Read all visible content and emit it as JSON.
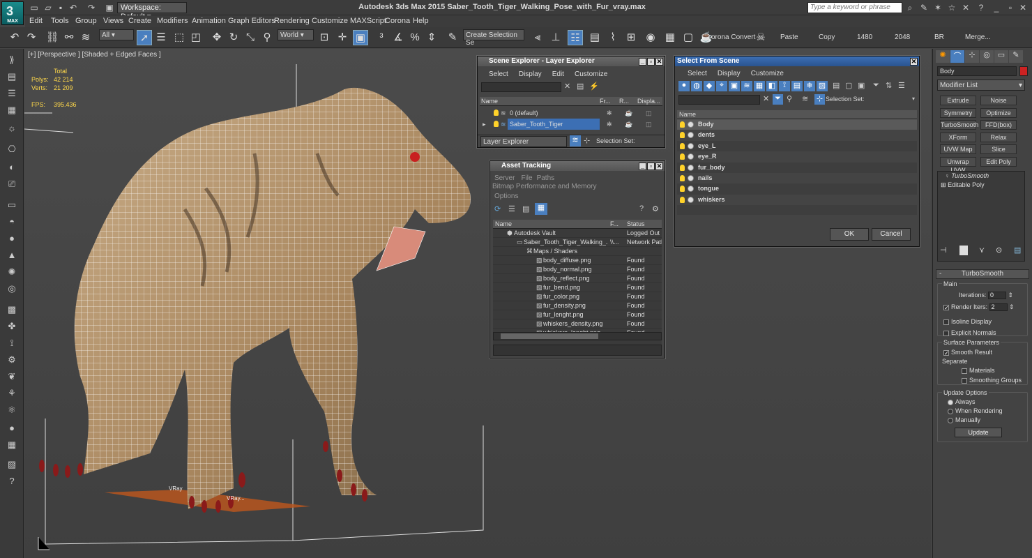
{
  "app": {
    "title": "Autodesk 3ds Max  2015    Saber_Tooth_Tiger_Walking_Pose_with_Fur_vray.max",
    "logo_text": "MAX",
    "workspace": "Workspace: Default",
    "search_placeholder": "Type a keyword or phrase"
  },
  "menu": [
    "Edit",
    "Tools",
    "Group",
    "Views",
    "Create",
    "Modifiers",
    "Animation",
    "Graph Editors",
    "Rendering",
    "Customize",
    "MAXScript",
    "Corona",
    "Help"
  ],
  "toolbar": {
    "selection_filter": "All",
    "coord_system": "World",
    "named_selection": "Create Selection Se",
    "corona_convert": "orona Convert",
    "paste": "Paste",
    "copy": "Copy",
    "width": "1480",
    "height": "2048",
    "br": "BR",
    "merge": "Merge..."
  },
  "viewport": {
    "label": "[+] [Perspective ] [Shaded + Edged Faces ]",
    "stats": {
      "total_label": "Total",
      "polys_label": "Polys:",
      "polys": "42 214",
      "verts_label": "Verts:",
      "verts": "21 209",
      "fps_label": "FPS:",
      "fps": "395.436"
    },
    "vray_label": "VRay",
    "vray_label2": "VRay..."
  },
  "scene_explorer": {
    "title": "Scene Explorer - Layer Explorer",
    "menu": [
      "Select",
      "Display",
      "Edit",
      "Customize"
    ],
    "columns": [
      "Name",
      "Fr...",
      "R...",
      "Displa..."
    ],
    "rows": [
      "0 (default)",
      "Saber_Tooth_Tiger"
    ],
    "footer_dropdown": "Layer Explorer",
    "selection_set": "Selection Set:"
  },
  "asset_tracking": {
    "title": "Asset Tracking",
    "menu": [
      "Server",
      "File",
      "Paths",
      "Bitmap Performance and Memory"
    ],
    "menu2": "Options",
    "columns": [
      "Name",
      "F...",
      "Status"
    ],
    "rows": [
      {
        "name": "Autodesk Vault",
        "f": "",
        "status": "Logged Out ("
      },
      {
        "name": "Saber_Tooth_Tiger_Walking_...",
        "f": "\\\\...",
        "status": "Network Path"
      },
      {
        "name": "Maps / Shaders",
        "f": "",
        "status": ""
      },
      {
        "name": "body_diffuse.png",
        "f": "",
        "status": "Found"
      },
      {
        "name": "body_normal.png",
        "f": "",
        "status": "Found"
      },
      {
        "name": "body_reflect.png",
        "f": "",
        "status": "Found"
      },
      {
        "name": "fur_bend.png",
        "f": "",
        "status": "Found"
      },
      {
        "name": "fur_color.png",
        "f": "",
        "status": "Found"
      },
      {
        "name": "fur_density.png",
        "f": "",
        "status": "Found"
      },
      {
        "name": "fur_lenght.png",
        "f": "",
        "status": "Found"
      },
      {
        "name": "whiskers_density.png",
        "f": "",
        "status": "Found"
      },
      {
        "name": "whiskers_lenght.png",
        "f": "",
        "status": "Found"
      }
    ]
  },
  "select_from_scene": {
    "title": "Select From Scene",
    "menu": [
      "Select",
      "Display",
      "Customize"
    ],
    "selection_set": "Selection Set:",
    "column": "Name",
    "objects": [
      "Body",
      "dents",
      "eye_L",
      "eye_R",
      "fur_body",
      "nails",
      "tongue",
      "whiskers"
    ],
    "ok": "OK",
    "cancel": "Cancel"
  },
  "command_panel": {
    "object_name": "Body",
    "object_color": "#cc2222",
    "modifier_list": "Modifier List",
    "buttons": [
      "Extrude",
      "Noise",
      "Symmetry",
      "Optimize",
      "TurboSmooth",
      "FFD(box)",
      "XForm",
      "Relax",
      "UVW Map",
      "Slice",
      "Unwrap UVW",
      "Edit Poly"
    ],
    "stack": [
      "TurboSmooth",
      "Editable Poly"
    ],
    "rollout_title": "TurboSmooth",
    "main_label": "Main",
    "iterations_label": "Iterations:",
    "iterations": "0",
    "render_iters_label": "Render Iters:",
    "render_iters": "2",
    "isoline": "Isoline Display",
    "explicit_normals": "Explicit Normals",
    "surface_params": "Surface Parameters",
    "smooth_result": "Smooth Result",
    "separate": "Separate",
    "materials": "Materials",
    "smoothing_groups": "Smoothing Groups",
    "update_options": "Update Options",
    "always": "Always",
    "when_rendering": "When Rendering",
    "manually": "Manually",
    "update_btn": "Update"
  },
  "colors": {
    "accent": "#3c6fb4",
    "stats_yellow": "#ffd84a"
  }
}
